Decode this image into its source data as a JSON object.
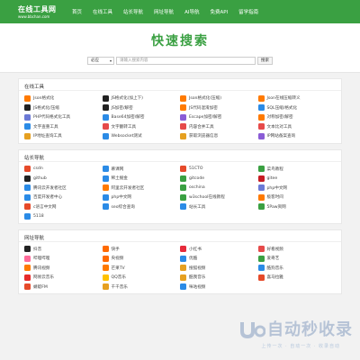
{
  "header": {
    "logo_title": "在线工具网",
    "logo_url": "www.bbchan.com",
    "nav": [
      "首页",
      "在线工具",
      "站长导航",
      "网址导航",
      "AI导航",
      "免费API",
      "留学指南"
    ]
  },
  "hero": {
    "title": "快速搜索",
    "engine": "必应",
    "placeholder": "请输入搜索内容",
    "button": "搜索"
  },
  "sections": [
    {
      "title": "在线工具",
      "items": [
        {
          "label": "Json格式化",
          "icon": "json-icon",
          "color": "#ff7a00"
        },
        {
          "label": "JS格式化(加上下)",
          "icon": "js-icon",
          "color": "#222222"
        },
        {
          "label": "Json格式化(压缩)",
          "icon": "json-icon",
          "color": "#ff7a00"
        },
        {
          "label": "Json在线压缩转义",
          "icon": "json-icon",
          "color": "#ff7a00"
        },
        {
          "label": "JS格式化/压缩",
          "icon": "js-icon",
          "color": "#222222"
        },
        {
          "label": "JS加密/解密",
          "icon": "js-icon",
          "color": "#222222"
        },
        {
          "label": "JS代码混淆加密",
          "icon": "js-icon",
          "color": "#ff7a00"
        },
        {
          "label": "SQL压缩/格式化",
          "icon": "sql-icon",
          "color": "#2b8be6"
        },
        {
          "label": "PHP代码格式化工具",
          "icon": "php-icon",
          "color": "#6c7ad6"
        },
        {
          "label": "Base64加密/解密",
          "icon": "base64-icon",
          "color": "#2b8be6"
        },
        {
          "label": "Escape加密/解密",
          "icon": "escape-icon",
          "color": "#8a5cd6"
        },
        {
          "label": "对称加密/解密",
          "icon": "lock-icon",
          "color": "#ff7a00"
        },
        {
          "label": "文字查重工具",
          "icon": "text-icon",
          "color": "#2b8be6"
        },
        {
          "label": "文字翻转工具",
          "icon": "text-icon",
          "color": "#e64a4a"
        },
        {
          "label": "内容合并工具",
          "icon": "merge-icon",
          "color": "#e64a4a"
        },
        {
          "label": "文本比对工具",
          "icon": "compare-icon",
          "color": "#e64a4a"
        },
        {
          "label": "IP地址查询工具",
          "icon": "ip-icon",
          "color": "#e6a020"
        },
        {
          "label": "Websocket测试",
          "icon": "socket-icon",
          "color": "#2b8be6"
        },
        {
          "label": "获取浏览器信息",
          "icon": "browser-icon",
          "color": "#e6a020"
        },
        {
          "label": "IP网站备案查询",
          "icon": "record-icon",
          "color": "#8a5cd6"
        }
      ]
    },
    {
      "title": "站长导航",
      "items": [
        {
          "label": "csdn",
          "icon": "csdn-icon",
          "color": "#e64a2a"
        },
        {
          "label": "慕课网",
          "icon": "mooc-icon",
          "color": "#2b8be6"
        },
        {
          "label": "51CTO",
          "icon": "51cto-icon",
          "color": "#e64a2a"
        },
        {
          "label": "菜鸟教程",
          "icon": "runoob-icon",
          "color": "#3aa042"
        },
        {
          "label": "github",
          "icon": "github-icon",
          "color": "#222222"
        },
        {
          "label": "稀土掘金",
          "icon": "juejin-icon",
          "color": "#2b8be6"
        },
        {
          "label": "gitcode",
          "icon": "gitcode-icon",
          "color": "#3aa042"
        },
        {
          "label": "gitee",
          "icon": "gitee-icon",
          "color": "#c71d23"
        },
        {
          "label": "腾讯云开发者社区",
          "icon": "tencent-icon",
          "color": "#2b8be6"
        },
        {
          "label": "阿里云开发者社区",
          "icon": "aliyun-icon",
          "color": "#ff7a00"
        },
        {
          "label": "oschina",
          "icon": "oschina-icon",
          "color": "#3aa042"
        },
        {
          "label": "php中文网",
          "icon": "php-icon",
          "color": "#6c7ad6"
        },
        {
          "label": "百度开发者中心",
          "icon": "baidu-icon",
          "color": "#2b8be6"
        },
        {
          "label": "php中文网",
          "icon": "php-icon",
          "color": "#2b8be6"
        },
        {
          "label": "w3school在线教程",
          "icon": "w3-icon",
          "color": "#3aa042"
        },
        {
          "label": "极客时间",
          "icon": "geek-icon",
          "color": "#ff7a00"
        },
        {
          "label": "c语言中文网",
          "icon": "c-icon",
          "color": "#e64a2a"
        },
        {
          "label": "seo综合查询",
          "icon": "seo-icon",
          "color": "#2b8be6"
        },
        {
          "label": "站长工具",
          "icon": "chinaz-icon",
          "color": "#2b8be6"
        },
        {
          "label": "5Paw资网",
          "icon": "5paw-icon",
          "color": "#3aa042"
        },
        {
          "label": "5118",
          "icon": "5118-icon",
          "color": "#2b8be6"
        }
      ]
    },
    {
      "title": "网址导航",
      "items": [
        {
          "label": "抖音",
          "icon": "douyin-icon",
          "color": "#222222"
        },
        {
          "label": "快手",
          "icon": "kuaishou-icon",
          "color": "#ff6a00"
        },
        {
          "label": "小红书",
          "icon": "xhs-icon",
          "color": "#e62a3a"
        },
        {
          "label": "好看视频",
          "icon": "haokan-icon",
          "color": "#e64a4a"
        },
        {
          "label": "哔哩哔哩",
          "icon": "bilibili-icon",
          "color": "#ff6b9a"
        },
        {
          "label": "央视频",
          "icon": "cctv-icon",
          "color": "#ff6a00"
        },
        {
          "label": "优酷",
          "icon": "youku-icon",
          "color": "#2b8be6"
        },
        {
          "label": "爱奇艺",
          "icon": "iqiyi-icon",
          "color": "#3aa042"
        },
        {
          "label": "腾讯视频",
          "icon": "qqvideo-icon",
          "color": "#ff7a00"
        },
        {
          "label": "芒果TV",
          "icon": "mango-icon",
          "color": "#ff7a00"
        },
        {
          "label": "搜狐视频",
          "icon": "sohu-icon",
          "color": "#e6a020"
        },
        {
          "label": "酷狗音乐",
          "icon": "kugou-icon",
          "color": "#2b8be6"
        },
        {
          "label": "网易云音乐",
          "icon": "netease-icon",
          "color": "#e62a2a"
        },
        {
          "label": "QQ音乐",
          "icon": "qqmusic-icon",
          "color": "#ffc200"
        },
        {
          "label": "酷我音乐",
          "icon": "kuwo-icon",
          "color": "#e6a020"
        },
        {
          "label": "喜马拉雅",
          "icon": "ximalaya-icon",
          "color": "#e64a2a"
        },
        {
          "label": "蜻蜓FM",
          "icon": "qingting-icon",
          "color": "#e64a2a"
        },
        {
          "label": "千千音乐",
          "icon": "qianqian-icon",
          "color": "#e6a020"
        },
        {
          "label": "咪咕视频",
          "icon": "migu-icon",
          "color": "#2b8be6"
        }
      ]
    }
  ],
  "watermark": {
    "text": "自动秒收录",
    "subtitle": "上传一次 · 自动一次 · 收录自动"
  }
}
